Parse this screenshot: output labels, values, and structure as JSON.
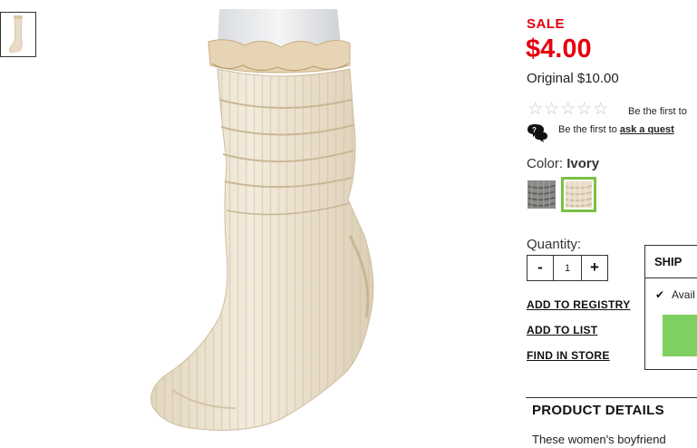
{
  "thumbnail": {
    "icon": "sock-thumbnail"
  },
  "main_image": {
    "icon": "ivory-sock-on-mannequin"
  },
  "pricing": {
    "sale_label": "SALE",
    "sale_price": "$4.00",
    "original_price": "Original $10.00",
    "sale_color": "#e4000f"
  },
  "reviews": {
    "stars": [
      "☆",
      "☆",
      "☆",
      "☆",
      "☆"
    ],
    "rating": 0,
    "text": "Be the first to"
  },
  "qa": {
    "icon": "qa-bubbles-icon",
    "prefix": "Be the first to",
    "link": "ask a quest"
  },
  "color": {
    "label": "Color:",
    "selected": "Ivory",
    "swatches": [
      {
        "name": "gray",
        "selected": false
      },
      {
        "name": "ivory",
        "selected": true
      }
    ],
    "selected_border": "#7ac142"
  },
  "quantity": {
    "label": "Quantity:",
    "minus": "-",
    "value": "1",
    "plus": "+"
  },
  "actions": {
    "registry": "ADD TO REGISTRY",
    "list": "ADD TO LIST",
    "store": "FIND IN STORE"
  },
  "ship": {
    "tab": "SHIP",
    "check": "✔",
    "availability": "Avail",
    "button_color": "#7ed160"
  },
  "details": {
    "title": "PRODUCT DETAILS",
    "text": "These women's boyfriend"
  }
}
